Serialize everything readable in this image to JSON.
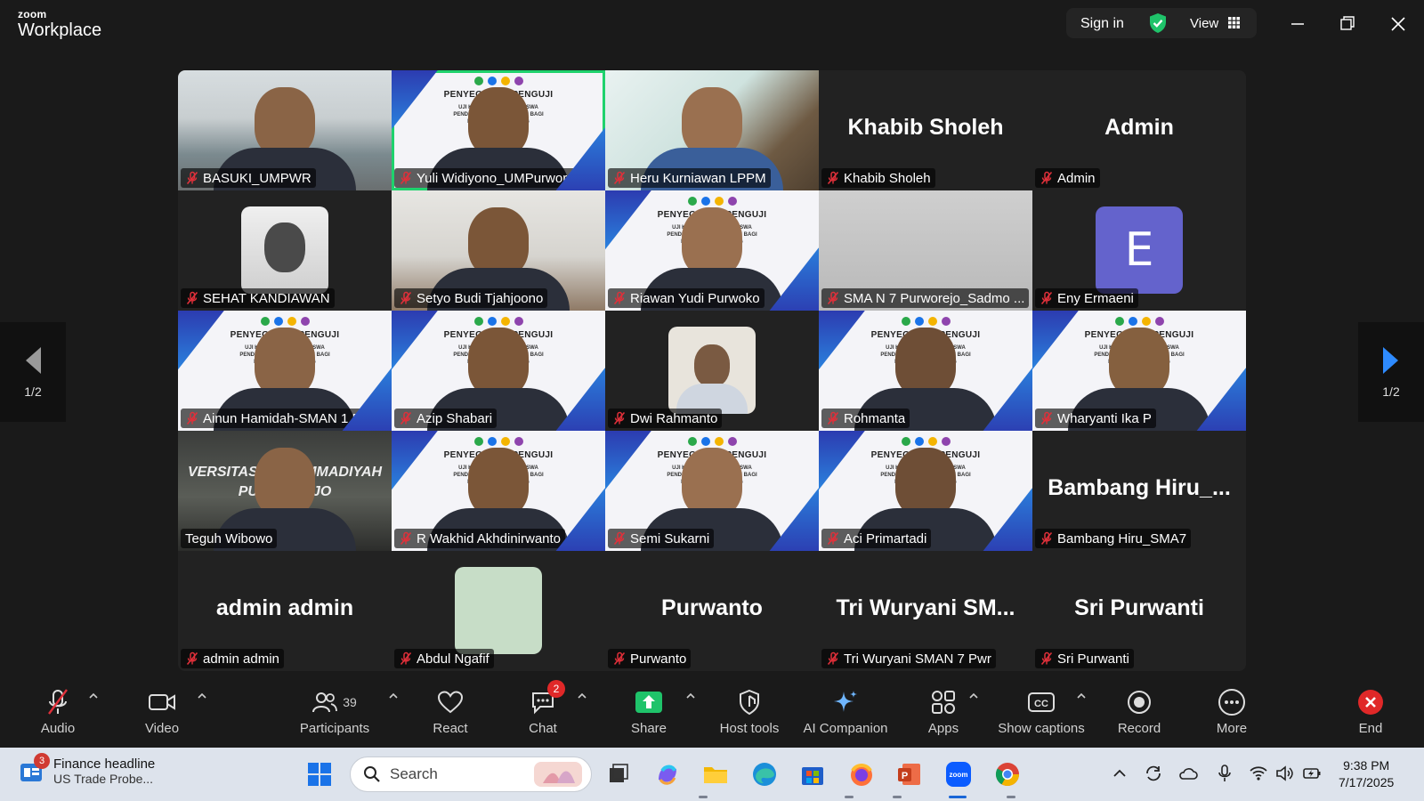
{
  "app": {
    "brand_top": "zoom",
    "brand_bottom": "Workplace"
  },
  "titlebar": {
    "sign_in": "Sign in",
    "view": "View"
  },
  "pager": {
    "left": "1/2",
    "right": "1/2"
  },
  "slide": {
    "title": "PENYEGARAN PENGUJI",
    "subtitle": "UJI KOMPETENSI MAHASISWA PENDIDIKAN PROFESI GURU BAGI DOSEN DAN GURU PPG"
  },
  "participants": [
    {
      "name": "BASUKI_UMPWR",
      "video": "room"
    },
    {
      "name": "Yuli Widiyono_UMPurworejo",
      "video": "slide",
      "active": true
    },
    {
      "name": "Heru Kurniawan LPPM",
      "video": "garden"
    },
    {
      "name": "Khabib Sholeh",
      "big_name": "Khabib Sholeh"
    },
    {
      "name": "Admin",
      "big_name": "Admin"
    },
    {
      "name": "SEHAT KANDIAWAN",
      "video": "photo"
    },
    {
      "name": "Setyo Budi Tjahjoono",
      "video": "house"
    },
    {
      "name": "Riawan Yudi Purwoko",
      "video": "slide"
    },
    {
      "name": "SMA N 7 Purworejo_Sadmo ...",
      "video": "blur"
    },
    {
      "name": "Eny Ermaeni",
      "initial": "E"
    },
    {
      "name": "Ainun Hamidah-SMAN 1 Pu...",
      "video": "slide"
    },
    {
      "name": "Azip Shabari",
      "video": "slide"
    },
    {
      "name": "Dwi Rahmanto",
      "video": "photo2"
    },
    {
      "name": "Rohmanta",
      "video": "slide"
    },
    {
      "name": "Wharyanti Ika P",
      "video": "slide"
    },
    {
      "name": "Teguh Wibowo",
      "video": "campus",
      "unmuted": true,
      "campus_text": "VERSITAS MUHAMMADIYAH PURWOREJO"
    },
    {
      "name": "R Wakhid Akhdinirwanto",
      "video": "slide"
    },
    {
      "name": "Semi Sukarni",
      "video": "slide"
    },
    {
      "name": "Aci Primartadi",
      "video": "slide"
    },
    {
      "name": "Bambang Hiru_SMA7",
      "big_name": "Bambang  Hiru_..."
    },
    {
      "name": "admin admin",
      "big_name": "admin admin"
    },
    {
      "name": "Abdul Ngafif",
      "video": "avatar-green"
    },
    {
      "name": "Purwanto",
      "big_name": "Purwanto"
    },
    {
      "name": "Tri Wuryani SMAN 7 Pwr",
      "big_name": "Tri  Wuryani  SM..."
    },
    {
      "name": "Sri Purwanti",
      "big_name": "Sri Purwanti"
    }
  ],
  "toolbar": {
    "audio": "Audio",
    "video": "Video",
    "participants": "Participants",
    "participants_count": "39",
    "react": "React",
    "chat": "Chat",
    "chat_badge": "2",
    "share": "Share",
    "host_tools": "Host tools",
    "ai_companion": "AI Companion",
    "apps": "Apps",
    "captions": "Show captions",
    "record": "Record",
    "more": "More",
    "end": "End"
  },
  "taskbar": {
    "news_badge": "3",
    "news_title": "Finance headline",
    "news_sub": "US Trade Probe...",
    "search": "Search",
    "time": "9:38 PM",
    "date": "7/17/2025"
  },
  "colors": {
    "active_speaker": "#1fd26d",
    "mute_red": "#e0303a",
    "end_red": "#e02828",
    "share_green": "#1fc36a",
    "avatar_purple": "#6463cc"
  }
}
